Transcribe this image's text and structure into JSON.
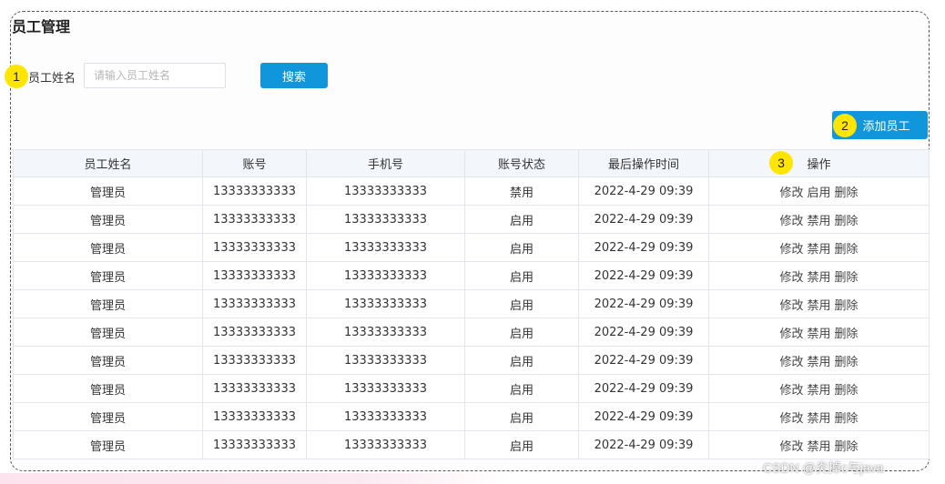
{
  "page": {
    "title": "员工管理"
  },
  "markers": [
    "1",
    "2",
    "3"
  ],
  "search": {
    "label": "员工姓名",
    "placeholder": "请输入员工姓名",
    "value": "",
    "button_label": "搜索"
  },
  "toolbar": {
    "add_label": "添加员工"
  },
  "table": {
    "columns": [
      "员工姓名",
      "账号",
      "手机号",
      "账号状态",
      "最后操作时间",
      "操作"
    ],
    "rows": [
      {
        "name": "管理员",
        "account": "13333333333",
        "phone": "13333333333",
        "status": "禁用",
        "time": "2022-4-29 09:39",
        "actions": [
          "修改",
          "启用",
          "删除"
        ]
      },
      {
        "name": "管理员",
        "account": "13333333333",
        "phone": "13333333333",
        "status": "启用",
        "time": "2022-4-29 09:39",
        "actions": [
          "修改",
          "禁用",
          "删除"
        ]
      },
      {
        "name": "管理员",
        "account": "13333333333",
        "phone": "13333333333",
        "status": "启用",
        "time": "2022-4-29 09:39",
        "actions": [
          "修改",
          "禁用",
          "删除"
        ]
      },
      {
        "name": "管理员",
        "account": "13333333333",
        "phone": "13333333333",
        "status": "启用",
        "time": "2022-4-29 09:39",
        "actions": [
          "修改",
          "禁用",
          "删除"
        ]
      },
      {
        "name": "管理员",
        "account": "13333333333",
        "phone": "13333333333",
        "status": "启用",
        "time": "2022-4-29 09:39",
        "actions": [
          "修改",
          "禁用",
          "删除"
        ]
      },
      {
        "name": "管理员",
        "account": "13333333333",
        "phone": "13333333333",
        "status": "启用",
        "time": "2022-4-29 09:39",
        "actions": [
          "修改",
          "禁用",
          "删除"
        ]
      },
      {
        "name": "管理员",
        "account": "13333333333",
        "phone": "13333333333",
        "status": "启用",
        "time": "2022-4-29 09:39",
        "actions": [
          "修改",
          "禁用",
          "删除"
        ]
      },
      {
        "name": "管理员",
        "account": "13333333333",
        "phone": "13333333333",
        "status": "启用",
        "time": "2022-4-29 09:39",
        "actions": [
          "修改",
          "禁用",
          "删除"
        ]
      },
      {
        "name": "管理员",
        "account": "13333333333",
        "phone": "13333333333",
        "status": "启用",
        "time": "2022-4-29 09:39",
        "actions": [
          "修改",
          "禁用",
          "删除"
        ]
      },
      {
        "name": "管理员",
        "account": "13333333333",
        "phone": "13333333333",
        "status": "启用",
        "time": "2022-4-29 09:39",
        "actions": [
          "修改",
          "禁用",
          "删除"
        ]
      }
    ]
  },
  "watermark": "CSDN @炎掉c与java",
  "colors": {
    "primary": "#1296db",
    "marker": "#ffe500",
    "header_bg": "#f3f6fb",
    "border": "#e2e6ec"
  },
  "icons": {
    "cursor": "cursor-arrow-icon"
  }
}
